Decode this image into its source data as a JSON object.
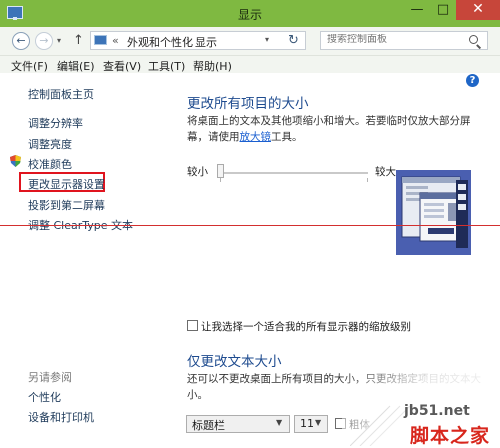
{
  "window": {
    "title": "显示",
    "minimize": "—",
    "maximize": "□",
    "close": "✕"
  },
  "address": {
    "segments": [
      "外观和个性化",
      "显示"
    ],
    "chevron": "«",
    "separator": "›",
    "search_placeholder": "搜索控制面板"
  },
  "menu": [
    "文件(F)",
    "编辑(E)",
    "查看(V)",
    "工具(T)",
    "帮助(H)"
  ],
  "sidebar": {
    "home": "控制面板主页",
    "items": [
      "调整分辨率",
      "调整亮度",
      "校准颜色",
      "更改显示器设置",
      "投影到第二屏幕",
      "调整 ClearType 文本"
    ],
    "see_also_title": "另请参阅",
    "see_also": [
      "个性化",
      "设备和打印机"
    ]
  },
  "main": {
    "title": "更改所有项目的大小",
    "desc_line1": "将桌面上的文本及其他项缩小和增大。若要临时仅放大部分屏",
    "desc_line2_prefix": "幕，请使用",
    "desc_link": "放大镜",
    "desc_line2_suffix": "工具。",
    "slider_min": "较小",
    "slider_max": "较大",
    "checkbox_label": "让我选择一个适合我的所有显示器的缩放级别",
    "text_title": "仅更改文本大小",
    "text_desc": "还可以不更改桌面上所有项目的大小，只更改指定项目的文本大",
    "text_desc2": "小。",
    "element_select": "标题栏",
    "size_select": "11",
    "bold_label": "粗体"
  },
  "watermark": {
    "url": "jb51.net",
    "brand": "脚本之家"
  },
  "colors": {
    "titlebar": "#7fb941",
    "highlight_box": "#e0141e",
    "heading": "#1e4b8f",
    "link": "#1a5fd0"
  }
}
